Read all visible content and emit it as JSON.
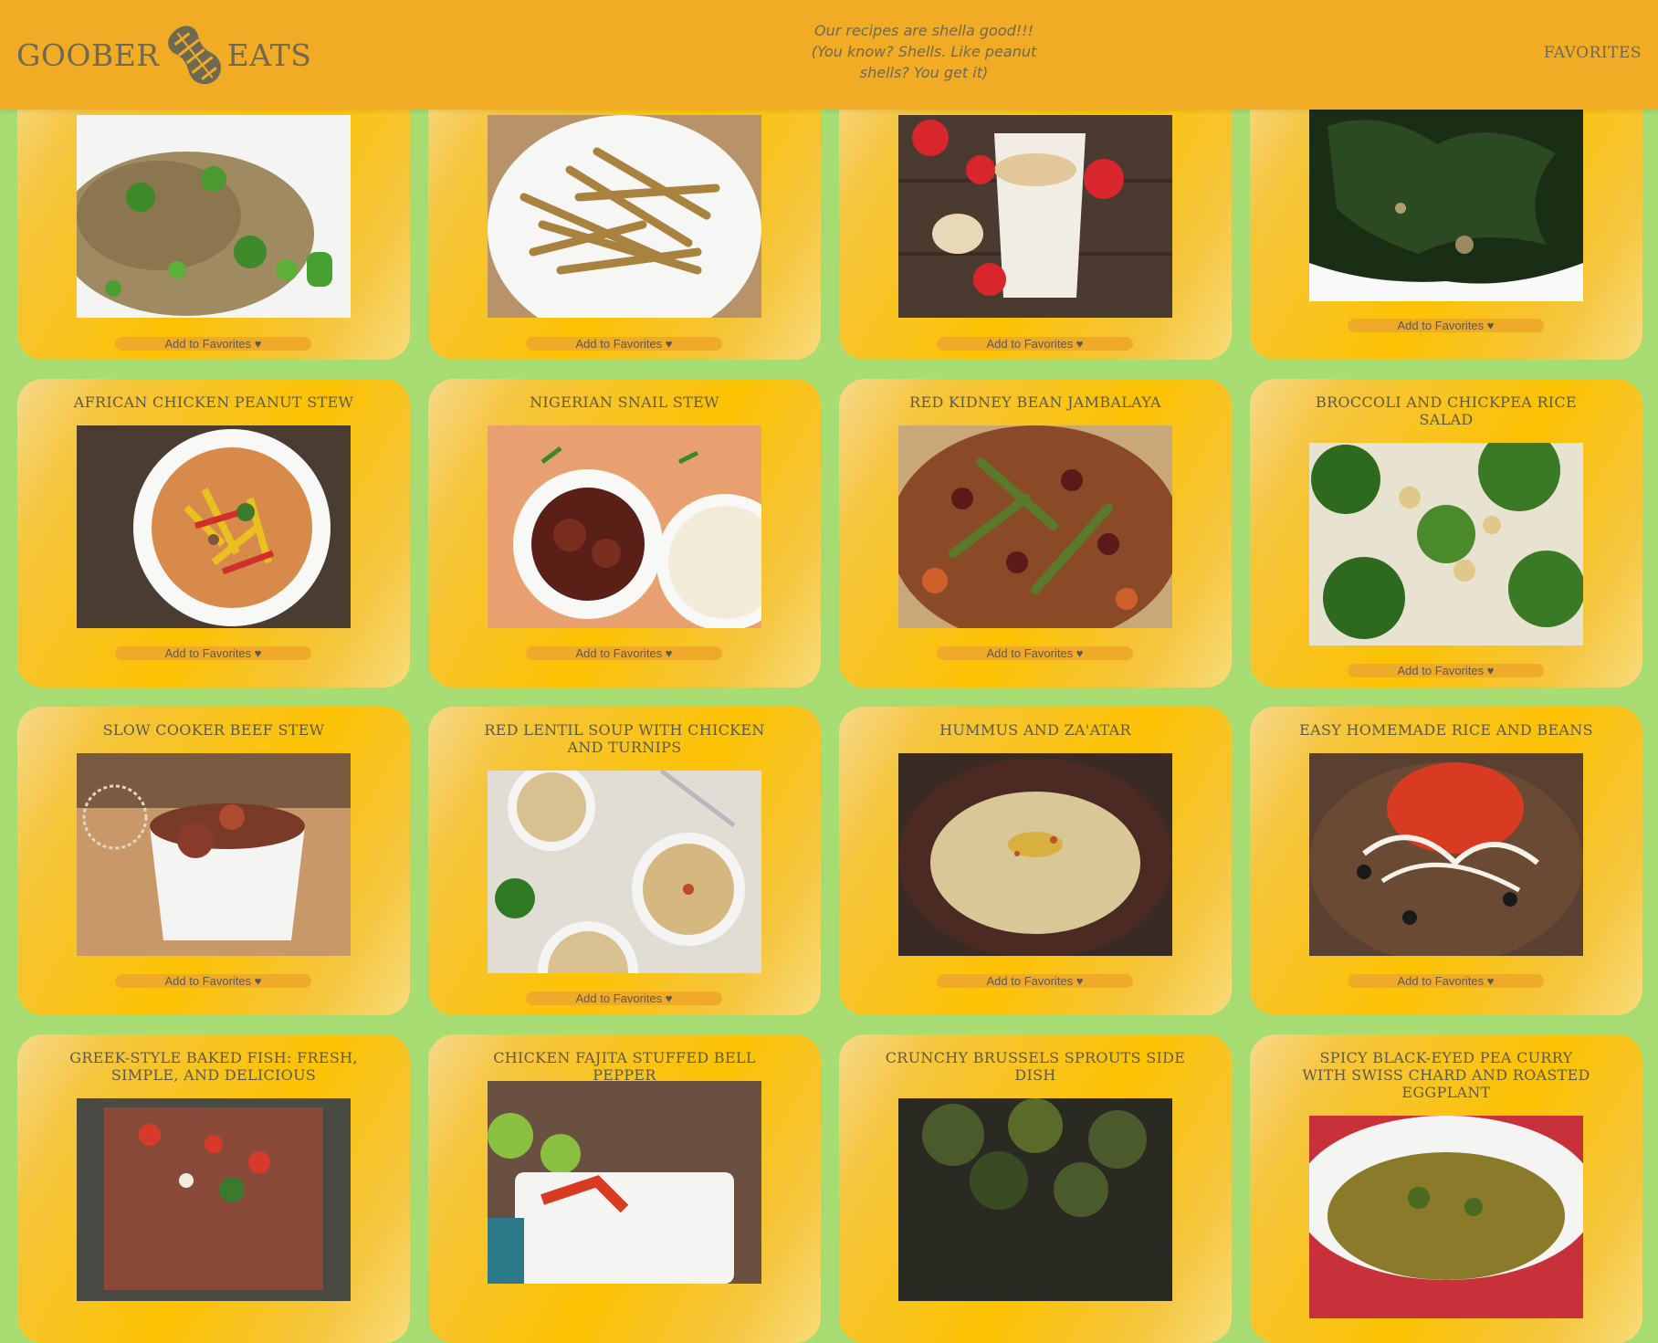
{
  "header": {
    "logo_left": "GOOBER",
    "logo_right": "EATS",
    "logo_icon": "peanut-icon",
    "tagline": "Our recipes are shella good!!! (You know? Shells. Like peanut shells? You get it)",
    "favorites_link": "FAVORITES"
  },
  "add_to_favorites_label": "Add to Favorites ♥",
  "recipes": [
    {
      "title": "",
      "image": "fried-rice-with-broccoli-and-peas"
    },
    {
      "title": "",
      "image": "baked-fries-on-plate"
    },
    {
      "title": "",
      "image": "peanut-smoothie-with-strawberries"
    },
    {
      "title": "",
      "image": "sauteed-kale"
    },
    {
      "title": "African Chicken Peanut Stew",
      "image": "chicken-peanut-stew-bowl"
    },
    {
      "title": "Nigerian Snail Stew",
      "image": "snail-stew-with-rice"
    },
    {
      "title": "Red Kidney Bean Jambalaya",
      "image": "bean-jambalaya"
    },
    {
      "title": "Broccoli and Chickpea Rice Salad",
      "image": "broccoli-chickpea-rice"
    },
    {
      "title": "Slow Cooker Beef Stew",
      "image": "beef-stew-ramekin"
    },
    {
      "title": "Red Lentil Soup with Chicken and Turnips",
      "image": "lentil-soup-bowls"
    },
    {
      "title": "Hummus and Za'atar",
      "image": "hummus-bowl"
    },
    {
      "title": "Easy Homemade Rice and Beans",
      "image": "rice-and-beans-salsa"
    },
    {
      "title": "Greek-Style Baked Fish: Fresh, Simple, and Delicious",
      "image": "greek-baked-fish"
    },
    {
      "title": "Chicken Fajita Stuffed Bell Pepper",
      "image": "stuffed-bell-pepper"
    },
    {
      "title": "Crunchy Brussels Sprouts Side Dish",
      "image": "roasted-brussels-sprouts"
    },
    {
      "title": "Spicy Black-Eyed Pea Curry with Swiss Chard and Roasted Eggplant",
      "image": "black-eyed-pea-curry"
    }
  ],
  "colors": {
    "background": "#a6dc72",
    "header": "#f1ab25",
    "card": "#fcc203",
    "button": "#efaa2a",
    "text": "#5f5a48"
  }
}
